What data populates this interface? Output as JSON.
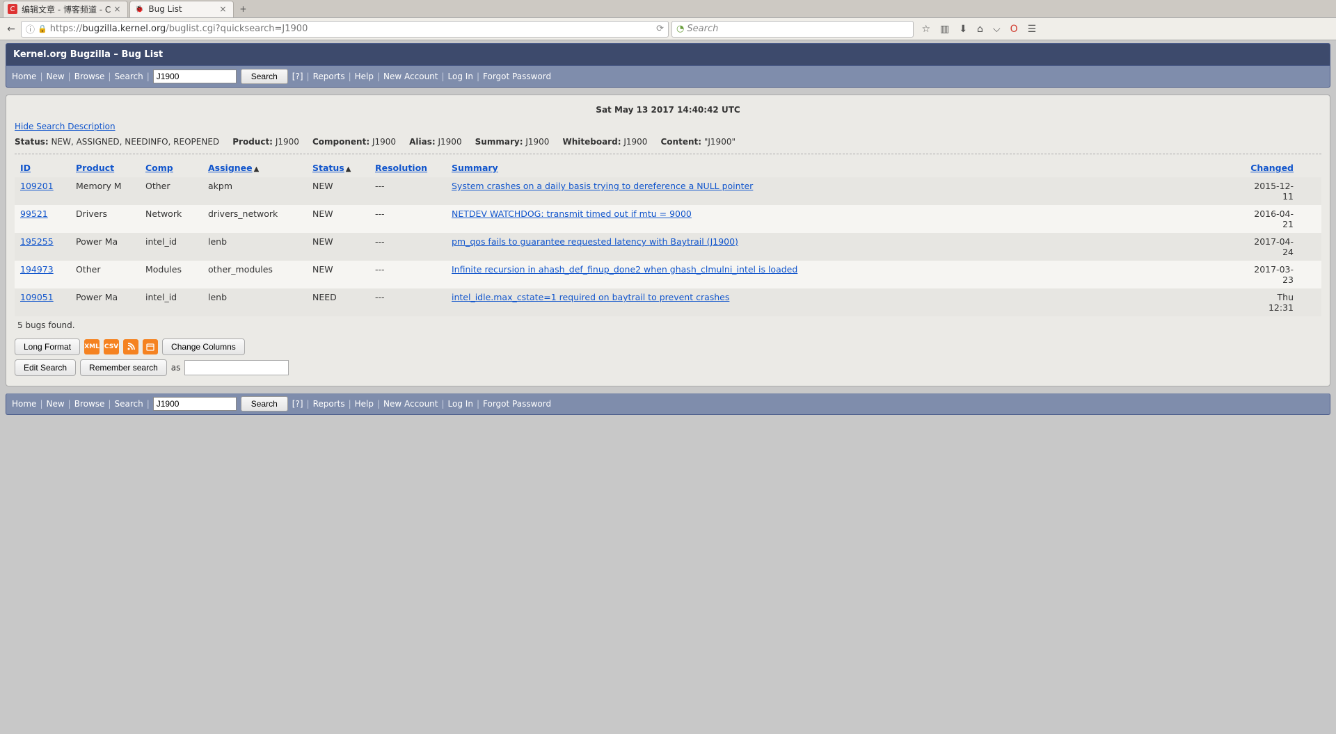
{
  "browser": {
    "tabs": [
      {
        "title": "编辑文章 - 博客频道 - C",
        "active": false
      },
      {
        "title": "Bug List",
        "active": true
      }
    ],
    "url_prefix": "https://",
    "url_host": "bugzilla.kernel.org",
    "url_path": "/buglist.cgi?quicksearch=J1900",
    "search_placeholder": "Search"
  },
  "page": {
    "title": "Kernel.org Bugzilla – Bug List",
    "nav": {
      "home": "Home",
      "new": "New",
      "browse": "Browse",
      "search_link": "Search",
      "quicksearch_value": "J1900",
      "search_btn": "Search",
      "help_q": "[?]",
      "reports": "Reports",
      "help": "Help",
      "new_account": "New Account",
      "login": "Log In",
      "forgot": "Forgot Password"
    },
    "timestamp": "Sat May 13 2017 14:40:42 UTC",
    "hide_search": "Hide Search Description",
    "criteria": {
      "status_label": "Status:",
      "status": "NEW, ASSIGNED, NEEDINFO, REOPENED",
      "product_label": "Product:",
      "product": "J1900",
      "component_label": "Component:",
      "component": "J1900",
      "alias_label": "Alias:",
      "alias": "J1900",
      "summary_label": "Summary:",
      "summary": "J1900",
      "whiteboard_label": "Whiteboard:",
      "whiteboard": "J1900",
      "content_label": "Content:",
      "content": "\"J1900\""
    },
    "columns": {
      "id": "ID",
      "product": "Product",
      "comp": "Comp",
      "assignee": "Assignee",
      "status": "Status",
      "resolution": "Resolution",
      "summary": "Summary",
      "changed": "Changed"
    },
    "rows": [
      {
        "id": "109201",
        "product": "Memory M",
        "comp": "Other",
        "assignee": "akpm",
        "status": "NEW",
        "resolution": "---",
        "summary": "System crashes on a daily basis trying to dereference a NULL pointer",
        "changed": "2015-12-11"
      },
      {
        "id": "99521",
        "product": "Drivers",
        "comp": "Network",
        "assignee": "drivers_network",
        "status": "NEW",
        "resolution": "---",
        "summary": "NETDEV WATCHDOG: transmit timed out if mtu = 9000",
        "changed": "2016-04-21"
      },
      {
        "id": "195255",
        "product": "Power Ma",
        "comp": "intel_id",
        "assignee": "lenb",
        "status": "NEW",
        "resolution": "---",
        "summary": "pm_qos fails to guarantee requested latency with Baytrail (J1900)",
        "changed": "2017-04-24"
      },
      {
        "id": "194973",
        "product": "Other",
        "comp": "Modules",
        "assignee": "other_modules",
        "status": "NEW",
        "resolution": "---",
        "summary": "Infinite recursion in ahash_def_finup_done2 when ghash_clmulni_intel is loaded",
        "changed": "2017-03-23"
      },
      {
        "id": "109051",
        "product": "Power Ma",
        "comp": "intel_id",
        "assignee": "lenb",
        "status": "NEED",
        "resolution": "---",
        "summary": "intel_idle.max_cstate=1 required on baytrail to prevent crashes",
        "changed": "Thu 12:31"
      }
    ],
    "bugs_found": "5 bugs found.",
    "actions": {
      "long_format": "Long Format",
      "xml": "XML",
      "csv": "CSV",
      "feed": "❍",
      "ical": "☰",
      "change_columns": "Change Columns",
      "edit_search": "Edit Search",
      "remember_search": "Remember search",
      "as": "as"
    }
  }
}
